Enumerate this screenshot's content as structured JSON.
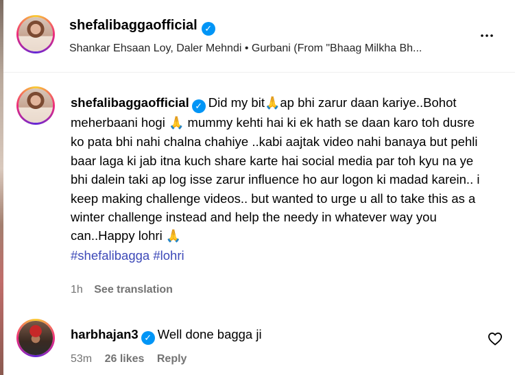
{
  "header": {
    "username": "shefalibagga​official",
    "audio": "Shankar Ehsaan Loy, Daler Mehndi • Gurbani (From \"Bhaag Milkha Bh..."
  },
  "caption": {
    "username": "shefalibagga​official",
    "part1": "Did my bit",
    "part2": "ap bhi zarur daan kariye..Bohot meherbaani hogi ",
    "part3": " mummy kehti hai ki ek hath se daan karo toh dusre ko pata bhi nahi chalna chahiye ..kabi aajtak video nahi banaya but pehli baar laga ki jab itna kuch share karte hai social media par toh kyu na ye bhi dalein taki ap log isse zarur influence ho aur logon ki madad karein.. i keep making challenge videos.. but wanted to urge u all to take this as a winter challenge instead and help the needy in whatever way you can..Happy lohri ",
    "emoji": "🙏",
    "hashtags": [
      "#shefalibagga",
      "#lohri"
    ],
    "time": "1h",
    "translation": "See translation"
  },
  "comment": {
    "username": "harbhajan3",
    "text": "Well done bagga ji",
    "time": "53m",
    "likes": "26 likes",
    "reply": "Reply"
  }
}
